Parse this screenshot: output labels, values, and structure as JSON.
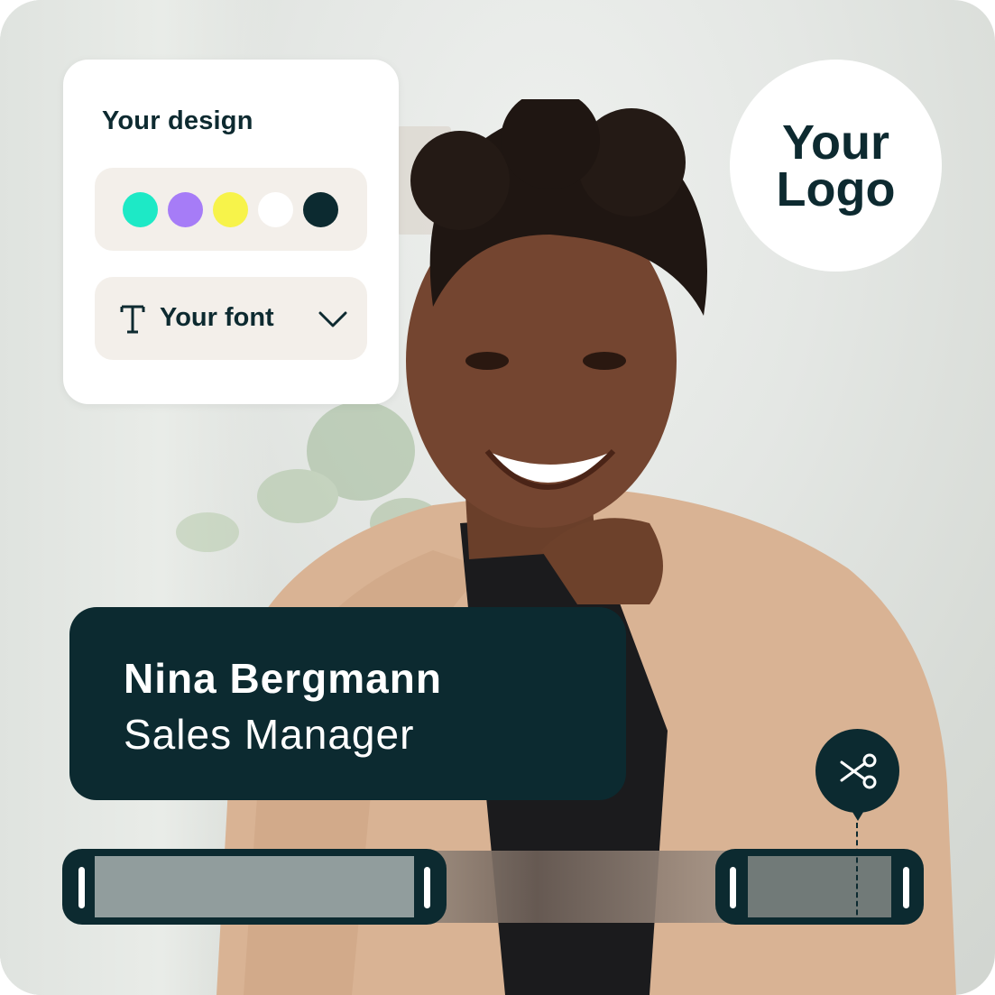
{
  "design_panel": {
    "title": "Your design",
    "swatches": [
      {
        "name": "turquoise",
        "color": "#1de9c6"
      },
      {
        "name": "purple",
        "color": "#a67cf7"
      },
      {
        "name": "yellow",
        "color": "#f7f34a"
      },
      {
        "name": "white",
        "color": "#ffffff"
      },
      {
        "name": "dark-teal",
        "color": "#0c2a30"
      }
    ],
    "font_selector": {
      "label": "Your font",
      "icon": "text-type-icon",
      "chevron_icon": "chevron-down-icon"
    }
  },
  "logo": {
    "line1": "Your",
    "line2": "Logo"
  },
  "lower_third": {
    "name": "Nina Bergmann",
    "role": "Sales Manager"
  },
  "timeline": {
    "cut_icon": "scissors-icon"
  },
  "colors": {
    "brand_dark": "#0c2a30",
    "panel_bg": "#f3efea",
    "card_bg": "#ffffff"
  }
}
